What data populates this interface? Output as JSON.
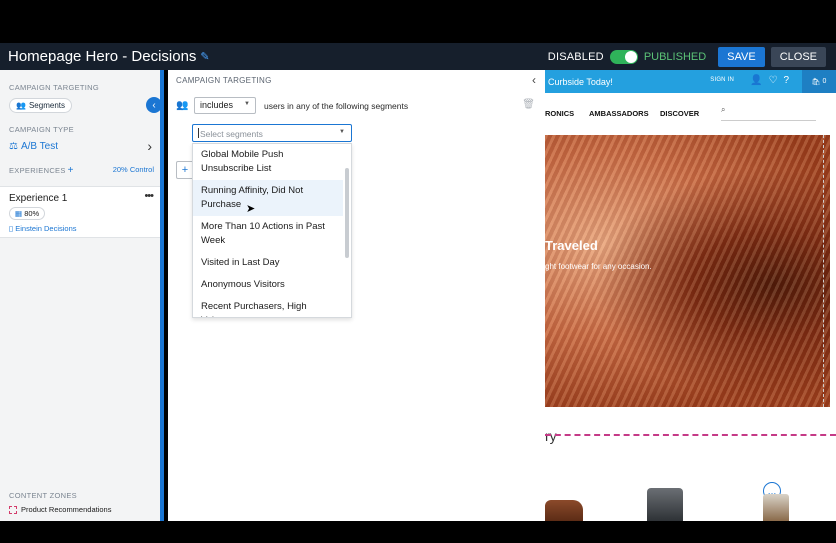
{
  "app": {
    "title": "Homepage Hero - Decisions",
    "status_disabled": "DISABLED",
    "status_published": "PUBLISHED",
    "save_label": "SAVE",
    "close_label": "CLOSE"
  },
  "sidebar": {
    "campaign_targeting_label": "CAMPAIGN TARGETING",
    "segments_pill": "Segments",
    "campaign_type_label": "CAMPAIGN TYPE",
    "campaign_type_value": "A/B Test",
    "experiences_label": "EXPERIENCES",
    "control_link": "20% Control",
    "experience": {
      "title": "Experience 1",
      "percent": "80%",
      "einstein": "Einstein Decisions"
    },
    "content_zones_label": "CONTENT ZONES",
    "content_zone_item": "Product Recommendations"
  },
  "panel": {
    "header": "CAMPAIGN TARGETING",
    "operator": "includes",
    "row_text": "users in any of the following segments",
    "segment_placeholder": "Select segments",
    "dropdown_items": [
      "Global Mobile Push Unsubscribe List",
      "Running Affinity, Did Not Purchase",
      "More Than 10 Actions in Past Week",
      "Visited in Last Day",
      "Anonymous Visitors",
      "Recent Purchasers, High Value,"
    ]
  },
  "site": {
    "promo_text": "Curbside Today!",
    "signin": "SIGN IN",
    "cart_count": "0",
    "nav": [
      "RONICS",
      "AMBASSADORS",
      "DISCOVER"
    ],
    "search_placeholder": "Search",
    "hero_title": "Traveled",
    "hero_sub": "ght footwear for any occasion.",
    "section_letter": "ry"
  }
}
